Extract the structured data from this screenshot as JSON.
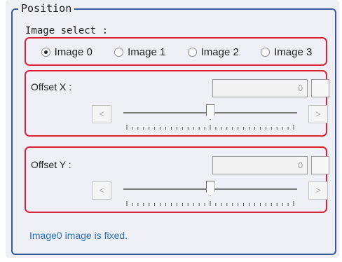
{
  "group": {
    "title": "Position",
    "image_select_label": "Image select :",
    "image_options": [
      {
        "label": "Image 0",
        "checked": true
      },
      {
        "label": "Image 1",
        "checked": false
      },
      {
        "label": "Image 2",
        "checked": false
      },
      {
        "label": "Image 3",
        "checked": false
      }
    ],
    "offset_x": {
      "label": "Offset X :",
      "value": "0",
      "left_arrow": "<",
      "right_arrow": ">",
      "slider_value_fraction": 0.5
    },
    "offset_y": {
      "label": "Offset Y :",
      "value": "0",
      "left_arrow": "<",
      "right_arrow": ">",
      "slider_value_fraction": 0.5
    },
    "status_message": "Image0 image is fixed."
  },
  "colors": {
    "frame_border": "#3a5a9a",
    "highlight_box": "#d8233a",
    "status_text": "#2d6fc4"
  }
}
